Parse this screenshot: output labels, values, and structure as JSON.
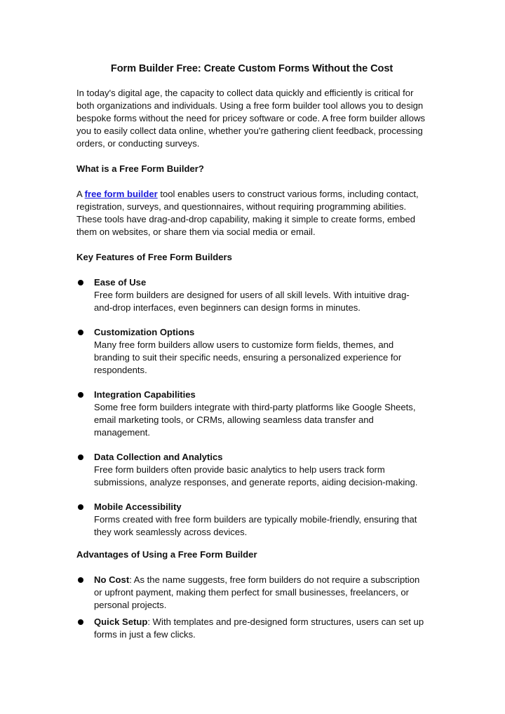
{
  "document": {
    "title": "Form Builder Free: Create Custom Forms Without the Cost",
    "intro": "In today's digital age, the capacity to collect data quickly and efficiently is critical for both organizations and individuals. Using a free form builder tool allows you to design bespoke forms without the need for pricey software or code. A free form builder allows you to easily collect data online, whether you're gathering client feedback, processing orders, or conducting surveys.",
    "section1": {
      "heading": "What is a Free Form Builder?",
      "prefix": "A ",
      "link_text": "free form builder",
      "link_color": "#1a1adb",
      "body": " tool enables users to construct various forms, including contact, registration, surveys, and questionnaires, without requiring programming abilities. These tools have drag-and-drop capability, making it simple to create forms, embed them on websites, or share them via social media or email."
    },
    "section2": {
      "heading": "Key Features of Free Form Builders",
      "items": [
        {
          "title": "Ease of Use",
          "text": "Free form builders are designed for users of all skill levels. With intuitive drag-and-drop interfaces, even beginners can design forms in minutes."
        },
        {
          "title": "Customization Options",
          "text": "Many free form builders allow users to customize form fields, themes, and branding to suit their specific needs, ensuring a personalized experience for respondents."
        },
        {
          "title": "Integration Capabilities",
          "text": "Some free form builders integrate with third-party platforms like Google Sheets, email marketing tools, or CRMs, allowing seamless data transfer and management."
        },
        {
          "title": "Data Collection and Analytics",
          "text": "Free form builders often provide basic analytics to help users track form submissions, analyze responses, and generate reports, aiding decision-making."
        },
        {
          "title": "Mobile Accessibility",
          "text": "Forms created with free form builders are typically mobile-friendly, ensuring that they work seamlessly across devices."
        }
      ]
    },
    "section3": {
      "heading": "Advantages of Using a Free Form Builder",
      "items": [
        {
          "title": "No Cost",
          "text": ": As the name suggests, free form builders do not require a subscription or upfront payment, making them perfect for small businesses, freelancers, or personal projects."
        },
        {
          "title": "Quick Setup",
          "text": ": With templates and pre-designed form structures, users can set up forms in just a few clicks."
        }
      ]
    }
  }
}
